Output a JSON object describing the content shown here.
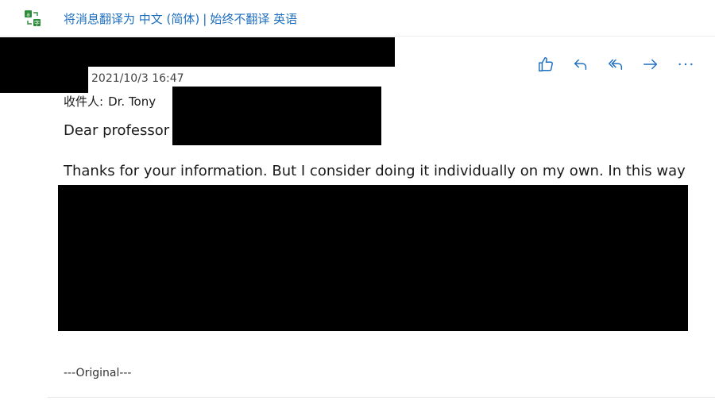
{
  "translation_bar": {
    "icon": "translate-icon",
    "translate_label": "将消息翻译为 中文 (简体)",
    "separator": "|",
    "never_translate_label": "始终不翻译 英语"
  },
  "message": {
    "date": "2021/10/3 16:47",
    "recipient_label": "收件人:",
    "recipient_name": "Dr. Tony",
    "greeting": "Dear professor",
    "paragraph_visible": "Thanks for your information. But I consider doing it individually on my own. In this way",
    "original_marker": "---Original---"
  },
  "actions": [
    {
      "name": "like",
      "icon": "thumbs-up-icon"
    },
    {
      "name": "reply",
      "icon": "reply-icon"
    },
    {
      "name": "reply-all",
      "icon": "reply-all-icon"
    },
    {
      "name": "forward",
      "icon": "forward-icon"
    },
    {
      "name": "more",
      "icon": "more-icon"
    }
  ],
  "colors": {
    "accent": "#1e6fc2",
    "text": "#1a1a1a",
    "redaction": "#000000"
  }
}
